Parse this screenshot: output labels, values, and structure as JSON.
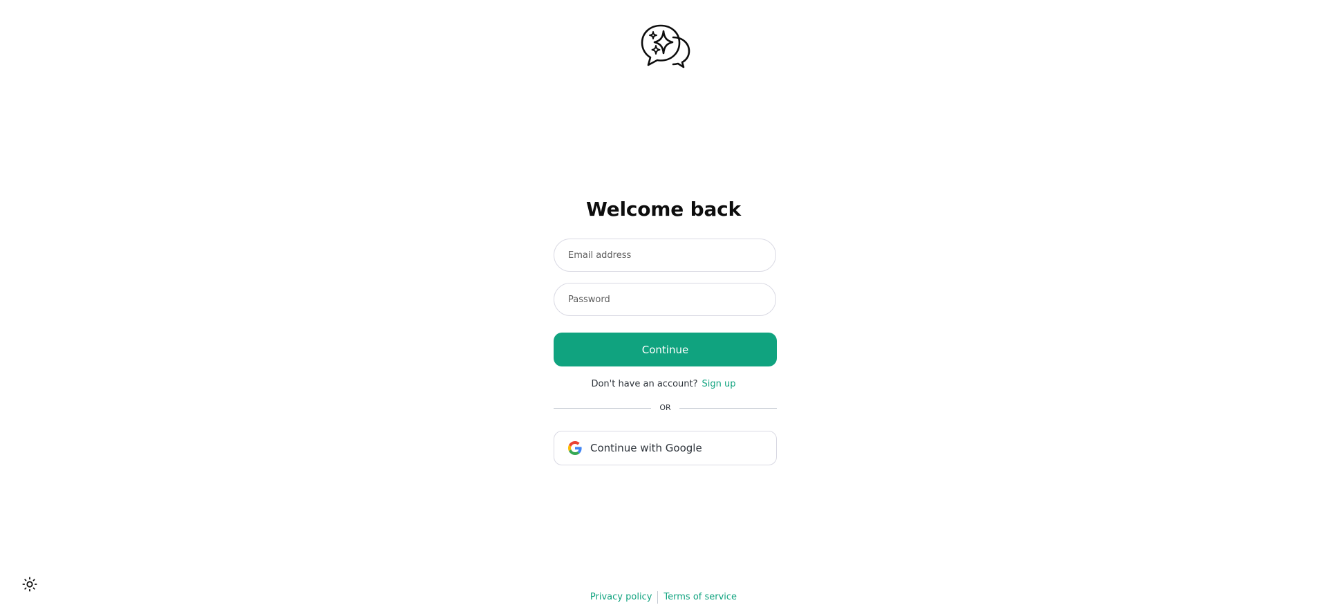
{
  "logo": {
    "icon": "chat-sparkle-icon"
  },
  "heading": {
    "title": "Welcome back"
  },
  "form": {
    "email_placeholder": "Email address",
    "password_placeholder": "Password",
    "continue_label": "Continue"
  },
  "signup": {
    "prompt": "Don't have an account?",
    "link_label": "Sign up"
  },
  "divider": {
    "label": "OR"
  },
  "social": {
    "google_label": "Continue with Google",
    "google_icon": "google-icon"
  },
  "theme": {
    "icon": "sun-icon"
  },
  "footer": {
    "privacy_label": "Privacy policy",
    "terms_label": "Terms of service"
  },
  "colors": {
    "accent": "#10a37f",
    "border": "#d9d9e3",
    "text": "#0d0d0d"
  }
}
